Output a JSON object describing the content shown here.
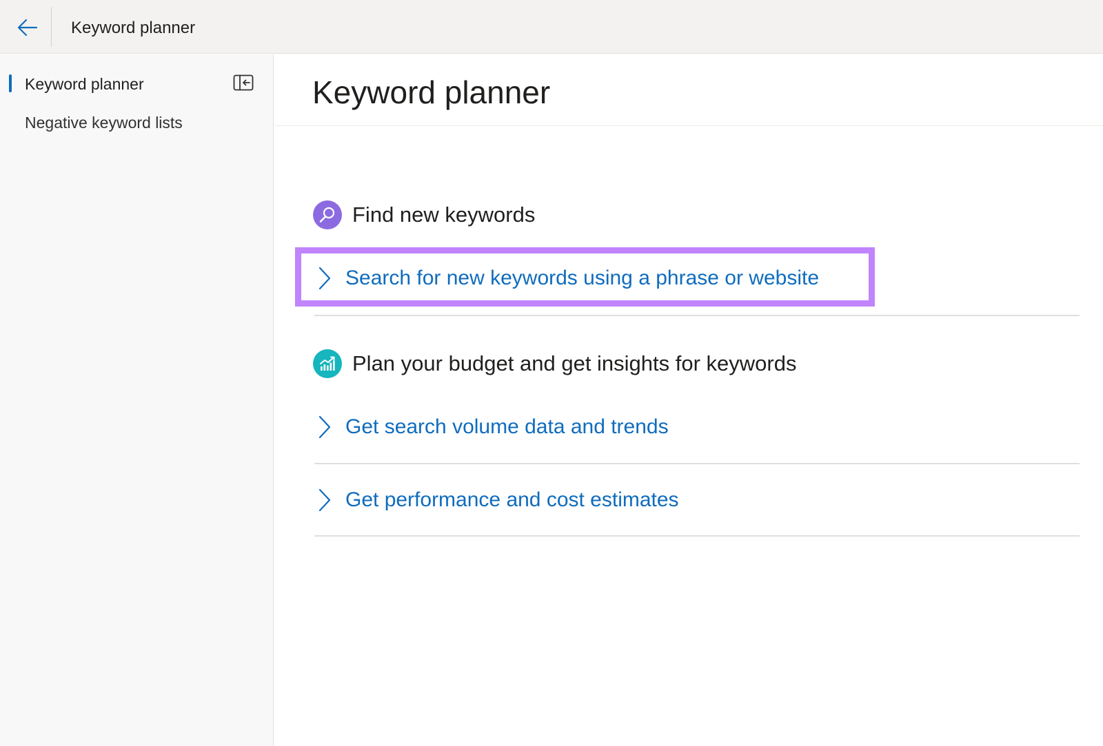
{
  "topbar": {
    "title": "Keyword planner",
    "back_icon": "arrow-left-icon"
  },
  "sidebar": {
    "items": [
      {
        "label": "Keyword planner",
        "active": true
      },
      {
        "label": "Negative keyword lists",
        "active": false
      }
    ],
    "collapse_icon": "collapse-panel-icon"
  },
  "main": {
    "title": "Keyword planner",
    "sections": [
      {
        "title": "Find new keywords",
        "icon": "magnifier-icon",
        "icon_color": "#8c6be0",
        "links": [
          {
            "label": "Search for new keywords using a phrase or website",
            "highlighted": true
          }
        ]
      },
      {
        "title": "Plan your budget and get insights for keywords",
        "icon": "chart-icon",
        "icon_color": "#17b5bd",
        "links": [
          {
            "label": "Get search volume data and trends"
          },
          {
            "label": "Get performance and cost estimates"
          }
        ]
      }
    ]
  },
  "colors": {
    "link": "#0f6cbd",
    "highlight": "#c084fc",
    "active_indicator": "#0f6cbd"
  }
}
